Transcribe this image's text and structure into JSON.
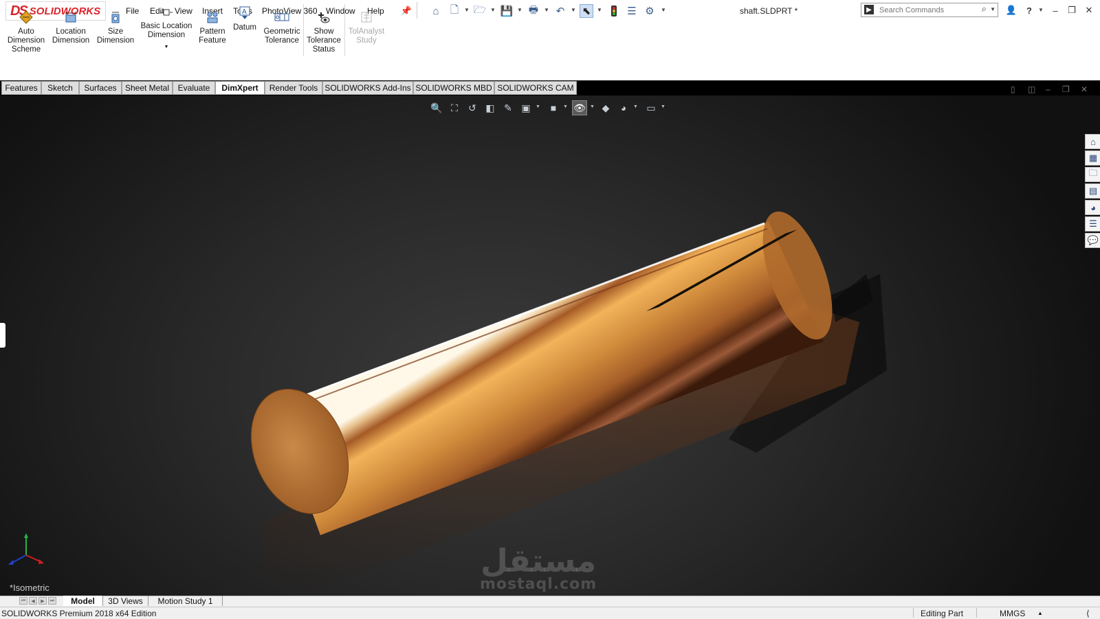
{
  "app": {
    "logo_ds": "DS",
    "logo_text_solid": "SOLID",
    "logo_text_works": "WORKS",
    "document_title": "shaft.SLDPRT *"
  },
  "menu": [
    "File",
    "Edit",
    "View",
    "Insert",
    "Tools",
    "PhotoView 360",
    "Window",
    "Help"
  ],
  "search": {
    "placeholder": "Search Commands"
  },
  "ribbon": {
    "commands": [
      {
        "label": "Auto Dimension Scheme",
        "icon": "auto-dimension-icon"
      },
      {
        "label": "Location Dimension",
        "icon": "location-dimension-icon"
      },
      {
        "label": "Size Dimension",
        "icon": "size-dimension-icon"
      },
      {
        "label": "Basic Location Dimension",
        "icon": "basic-location-dimension-icon"
      },
      {
        "label": "Pattern Feature",
        "icon": "pattern-feature-icon"
      },
      {
        "label": "Datum",
        "icon": "datum-icon"
      },
      {
        "label": "Geometric Tolerance",
        "icon": "geometric-tolerance-icon"
      },
      {
        "label": "Show Tolerance Status",
        "icon": "tolerance-status-icon"
      },
      {
        "label": "TolAnalyst Study",
        "icon": "tolanalyst-icon",
        "disabled": true
      }
    ]
  },
  "tabs": [
    {
      "label": "Features"
    },
    {
      "label": "Sketch"
    },
    {
      "label": "Surfaces"
    },
    {
      "label": "Sheet Metal"
    },
    {
      "label": "Evaluate"
    },
    {
      "label": "DimXpert",
      "active": true
    },
    {
      "label": "Render Tools"
    },
    {
      "label": "SOLIDWORKS Add-Ins"
    },
    {
      "label": "SOLIDWORKS MBD"
    },
    {
      "label": "SOLIDWORKS CAM"
    }
  ],
  "viewport": {
    "view_label": "*Isometric",
    "model": "copper cylindrical shaft with keyway",
    "colors": {
      "copper_light": "#f0b25a",
      "copper_mid": "#c47a2c",
      "copper_dark": "#5a2a10",
      "background": "#1c1c1c"
    }
  },
  "bottom_tabs": [
    {
      "label": "Model",
      "active": true
    },
    {
      "label": "3D Views"
    },
    {
      "label": "Motion Study 1"
    }
  ],
  "status": {
    "product": "SOLIDWORKS Premium 2018 x64 Edition",
    "mode": "Editing Part",
    "units": "MMGS"
  },
  "watermark": {
    "arabic": "مستقل",
    "latin": "mostaql.com"
  }
}
